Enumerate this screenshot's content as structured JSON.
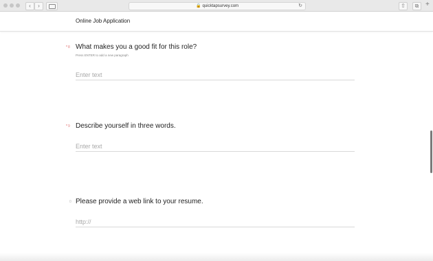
{
  "browser": {
    "url": "quicktapsurvey.com",
    "back_glyph": "‹",
    "forward_glyph": "›",
    "reload_glyph": "↻",
    "lock_glyph": "🔒",
    "share_glyph": "⇧",
    "tabs_glyph": "⧉",
    "plus_glyph": "+"
  },
  "header": {
    "title": "Online Job Application"
  },
  "questions": [
    {
      "number": "8",
      "required": true,
      "label": "What makes you a good fit for this role?",
      "hint": "Press ENTER to add a new paragraph",
      "placeholder": "Enter text",
      "value": ""
    },
    {
      "number": "9",
      "required": true,
      "label": "Describe yourself in three words.",
      "hint": "",
      "placeholder": "Enter text",
      "value": ""
    },
    {
      "number": "0",
      "required": false,
      "label": "Please provide a web link to your resume.",
      "hint": "",
      "placeholder": "http://",
      "value": ""
    }
  ],
  "required_marker": "*"
}
